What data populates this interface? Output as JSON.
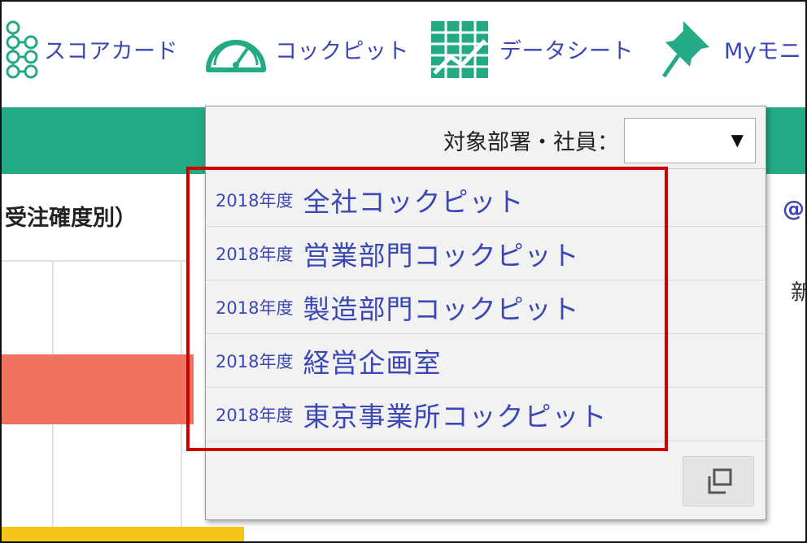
{
  "nav": {
    "scorecard": "スコアカード",
    "cockpit": "コックピット",
    "datasheet": "データシート",
    "mymonitor": "Myモニ"
  },
  "background": {
    "section_title": "受注確度別）",
    "at_sign": "@",
    "partial_char": "新"
  },
  "panel": {
    "filter_label": "対象部署・社員：",
    "select_value": "",
    "items": [
      {
        "year": "2018年度",
        "name": "全社コックピット"
      },
      {
        "year": "2018年度",
        "name": "営業部門コックピット"
      },
      {
        "year": "2018年度",
        "name": "製造部門コックピット"
      },
      {
        "year": "2018年度",
        "name": "経営企画室"
      },
      {
        "year": "2018年度",
        "name": "東京事業所コックピット"
      }
    ]
  },
  "colors": {
    "accent_green": "#23a984",
    "link_blue": "#3a47b5",
    "highlight_red": "#cc0000",
    "bar_red": "#f0735f",
    "bar_yellow": "#f5c518"
  }
}
